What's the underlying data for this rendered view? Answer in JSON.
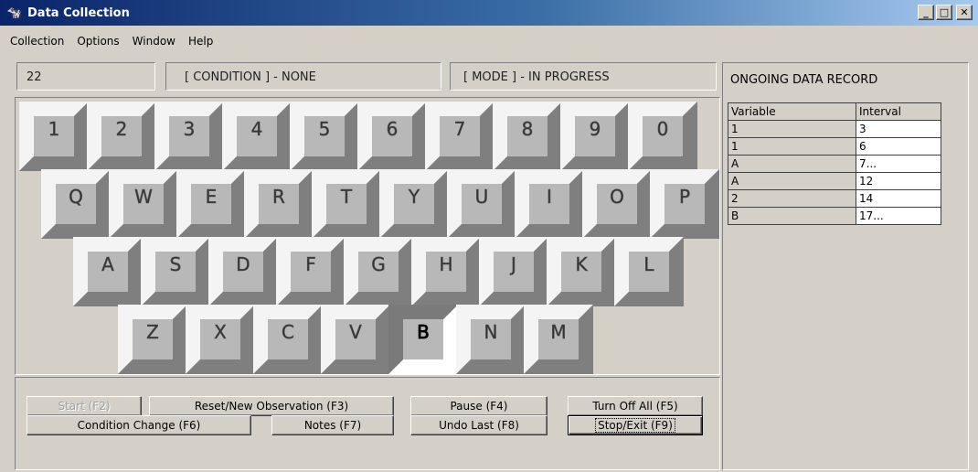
{
  "window": {
    "title": "Data Collection",
    "icon": "app-icon",
    "minimize": "_",
    "maximize": "□",
    "close": "✕"
  },
  "menu": [
    "Collection",
    "Options",
    "Window",
    "Help"
  ],
  "status": {
    "count": "22",
    "condition": "[ CONDITION ] - NONE",
    "mode": "[ MODE ] - IN PROGRESS"
  },
  "keyboard": {
    "rows": [
      [
        "1",
        "2",
        "3",
        "4",
        "5",
        "6",
        "7",
        "8",
        "9",
        "0"
      ],
      [
        "Q",
        "W",
        "E",
        "R",
        "T",
        "Y",
        "U",
        "I",
        "O",
        "P"
      ],
      [
        "A",
        "S",
        "D",
        "F",
        "G",
        "H",
        "J",
        "K",
        "L"
      ],
      [
        "Z",
        "X",
        "C",
        "V",
        "B",
        "N",
        "M"
      ]
    ],
    "pressed_key": "B"
  },
  "buttons": {
    "start": "Start (F2)",
    "reset": "Reset/New Observation (F3)",
    "pause": "Pause (F4)",
    "turn_off_all": "Turn Off All (F5)",
    "condition_change": "Condition Change (F6)",
    "notes": "Notes (F7)",
    "undo_last": "Undo Last (F8)",
    "stop_exit": "Stop/Exit (F9)"
  },
  "record": {
    "title": "ONGOING DATA RECORD",
    "columns": [
      "Variable",
      "Interval"
    ],
    "rows": [
      [
        "1",
        "3"
      ],
      [
        "1",
        "6"
      ],
      [
        "A",
        "7..."
      ],
      [
        "A",
        "12"
      ],
      [
        "2",
        "14"
      ],
      [
        "B",
        "17..."
      ]
    ]
  }
}
